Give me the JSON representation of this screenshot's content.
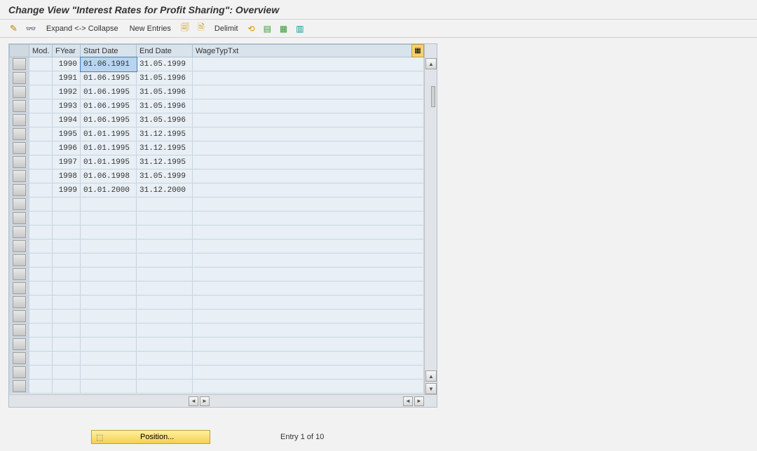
{
  "header": {
    "title": "Change View \"Interest Rates for Profit Sharing\": Overview"
  },
  "toolbar": {
    "expand_collapse_label": "Expand <-> Collapse",
    "new_entries_label": "New Entries",
    "delimit_label": "Delimit"
  },
  "columns": {
    "mod": "Mod.",
    "fyear": "FYear",
    "start_date": "Start Date",
    "end_date": "End Date",
    "wage_typ_txt": "WageTypTxt"
  },
  "rows": [
    {
      "mod": "",
      "fyear": "1990",
      "start": "01.06.1991",
      "end": "31.05.1999",
      "wage": "",
      "selected": true
    },
    {
      "mod": "",
      "fyear": "1991",
      "start": "01.06.1995",
      "end": "31.05.1996",
      "wage": ""
    },
    {
      "mod": "",
      "fyear": "1992",
      "start": "01.06.1995",
      "end": "31.05.1996",
      "wage": ""
    },
    {
      "mod": "",
      "fyear": "1993",
      "start": "01.06.1995",
      "end": "31.05.1996",
      "wage": ""
    },
    {
      "mod": "",
      "fyear": "1994",
      "start": "01.06.1995",
      "end": "31.05.1996",
      "wage": ""
    },
    {
      "mod": "",
      "fyear": "1995",
      "start": "01.01.1995",
      "end": "31.12.1995",
      "wage": ""
    },
    {
      "mod": "",
      "fyear": "1996",
      "start": "01.01.1995",
      "end": "31.12.1995",
      "wage": ""
    },
    {
      "mod": "",
      "fyear": "1997",
      "start": "01.01.1995",
      "end": "31.12.1995",
      "wage": ""
    },
    {
      "mod": "",
      "fyear": "1998",
      "start": "01.06.1998",
      "end": "31.05.1999",
      "wage": ""
    },
    {
      "mod": "",
      "fyear": "1999",
      "start": "01.01.2000",
      "end": "31.12.2000",
      "wage": ""
    }
  ],
  "empty_rows_count": 14,
  "footer": {
    "position_label": "Position...",
    "entry_text": "Entry 1 of 10"
  }
}
